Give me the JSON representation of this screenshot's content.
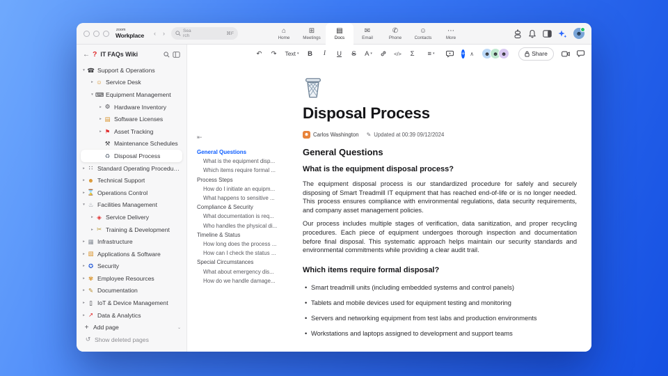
{
  "topbar": {
    "logo_small": "zoom",
    "logo_bold": "Workplace",
    "nav_prev": "‹",
    "nav_next": "›",
    "search": {
      "placeholder": "Search",
      "shortcut": "⌘F"
    },
    "tabs": [
      {
        "name": "home",
        "label": "Home",
        "glyph": "⌂"
      },
      {
        "name": "meetings",
        "label": "Meetings",
        "glyph": "⊞"
      },
      {
        "name": "docs",
        "label": "Docs",
        "glyph": "▤",
        "cls": "active"
      },
      {
        "name": "email",
        "label": "Email",
        "glyph": "✉"
      },
      {
        "name": "phone",
        "label": "Phone",
        "glyph": "✆"
      },
      {
        "name": "contacts",
        "label": "Contacts",
        "glyph": "☺"
      },
      {
        "name": "more",
        "label": "More",
        "glyph": "⋯"
      }
    ],
    "avatar_glyph": "☻"
  },
  "sidebar": {
    "title": "IT FAQs Wiki",
    "back_glyph": "←",
    "wiki_icon_glyph": "?",
    "items": [
      {
        "name": "support-operations",
        "label": "Support & Operations",
        "cls": "lv0",
        "chev": "▾",
        "icon": {
          "name": "phone-receiver-icon",
          "glyph": "☎",
          "color": "#3a3a3e"
        }
      },
      {
        "name": "service-desk",
        "label": "Service Desk",
        "cls": "lv1",
        "chev": "▸",
        "icon": {
          "name": "service-desk-icon",
          "glyph": "☺",
          "color": "#d9932b"
        }
      },
      {
        "name": "equipment-management",
        "label": "Equipment Management",
        "cls": "lv1",
        "chev": "▾",
        "icon": {
          "name": "computer-icon",
          "glyph": "⌨",
          "color": "#3a3a3e"
        }
      },
      {
        "name": "hardware-inventory",
        "label": "Hardware Inventory",
        "cls": "lv2",
        "chev": "▸",
        "icon": {
          "name": "hardware-icon",
          "glyph": "⚙",
          "color": "#4a4a50"
        }
      },
      {
        "name": "software-licenses",
        "label": "Software Licenses",
        "cls": "lv2",
        "chev": "▸",
        "icon": {
          "name": "license-card-icon",
          "glyph": "▤",
          "color": "#d9932b"
        }
      },
      {
        "name": "asset-tracking",
        "label": "Asset Tracking",
        "cls": "lv2",
        "chev": "▸",
        "icon": {
          "name": "pin-icon",
          "glyph": "⚑",
          "color": "#e02b2b"
        }
      },
      {
        "name": "maintenance-schedules",
        "label": "Maintenance Schedules",
        "cls": "lv2",
        "chev": "",
        "icon": {
          "name": "tools-icon",
          "glyph": "⚒",
          "color": "#3a3a3e"
        }
      },
      {
        "name": "disposal-process",
        "label": "Disposal Process",
        "cls": "lv2 selected",
        "chev": "",
        "icon": {
          "name": "wastebasket-icon",
          "glyph": "♻",
          "color": "#78828e"
        }
      },
      {
        "name": "standard-operating-procedures",
        "label": "Standard Operating Procedures",
        "cls": "lv0",
        "chev": "▸",
        "icon": {
          "name": "footprints-icon",
          "glyph": "∷",
          "color": "#3a3a3e"
        }
      },
      {
        "name": "technical-support",
        "label": "Technical Support",
        "cls": "lv0",
        "chev": "▸",
        "icon": {
          "name": "worker-icon",
          "glyph": "☻",
          "color": "#d9932b"
        }
      },
      {
        "name": "operations-control",
        "label": "Operations Control",
        "cls": "lv0",
        "chev": "▸",
        "icon": {
          "name": "hourglass-icon",
          "glyph": "⌛",
          "color": "#3a3a3e"
        }
      },
      {
        "name": "facilities-management",
        "label": "Facilities Management",
        "cls": "lv0",
        "chev": "▾",
        "icon": {
          "name": "facilities-icon",
          "glyph": "♨",
          "color": "#8a9099"
        }
      },
      {
        "name": "service-delivery",
        "label": "Service Delivery",
        "cls": "lv1",
        "chev": "▸",
        "icon": {
          "name": "truck-icon",
          "glyph": "◈",
          "color": "#e02b2b"
        }
      },
      {
        "name": "training-development",
        "label": "Training & Development",
        "cls": "lv1",
        "chev": "▸",
        "icon": {
          "name": "training-icon",
          "glyph": "✂",
          "color": "#b5952a"
        }
      },
      {
        "name": "infrastructure",
        "label": "Infrastructure",
        "cls": "lv0",
        "chev": "▸",
        "icon": {
          "name": "building-icon",
          "glyph": "▦",
          "color": "#8a9099"
        }
      },
      {
        "name": "applications-software",
        "label": "Applications & Software",
        "cls": "lv0",
        "chev": "▸",
        "icon": {
          "name": "laptop-icon",
          "glyph": "▧",
          "color": "#d9932b"
        }
      },
      {
        "name": "security",
        "label": "Security",
        "cls": "lv0",
        "chev": "▸",
        "icon": {
          "name": "officer-icon",
          "glyph": "✪",
          "color": "#2b5fd9"
        }
      },
      {
        "name": "employee-resources",
        "label": "Employee Resources",
        "cls": "lv0",
        "chev": "▸",
        "icon": {
          "name": "person-icon",
          "glyph": "✾",
          "color": "#d9932b"
        }
      },
      {
        "name": "documentation",
        "label": "Documentation",
        "cls": "lv0",
        "chev": "▸",
        "icon": {
          "name": "memo-pencil-icon",
          "glyph": "✎",
          "color": "#b5892a"
        }
      },
      {
        "name": "iot-device-management",
        "label": "IoT & Device Management",
        "cls": "lv0",
        "chev": "▸",
        "icon": {
          "name": "mobile-phone-icon",
          "glyph": "▯",
          "color": "#2e2e33"
        }
      },
      {
        "name": "data-analytics",
        "label": "Data & Analytics",
        "cls": "lv0",
        "chev": "▸",
        "icon": {
          "name": "chart-up-icon",
          "glyph": "↗",
          "color": "#e02b2b"
        }
      }
    ],
    "add_page_label": "Add page",
    "add_page_glyph": "+",
    "add_page_caret": "⌄",
    "show_deleted_label": "Show deleted pages",
    "show_deleted_glyph": "↺"
  },
  "toolbar": {
    "undo": "↶",
    "redo": "↷",
    "text_style": "Text",
    "caret": "▾",
    "bold": "B",
    "italic": "I",
    "underline": "U",
    "strikethrough": "S",
    "text_color": "A",
    "code": "</>",
    "equation": "Σ",
    "align": "≡",
    "collapse": "∧",
    "share_label": "Share",
    "ai_plus": "+",
    "avatars": [
      {
        "name": "collaborator-1",
        "color": "#bcd9f7",
        "glyph": "☻"
      },
      {
        "name": "collaborator-2",
        "color": "#bfe8cf",
        "glyph": "☻"
      },
      {
        "name": "collaborator-3",
        "color": "#d9c9f2",
        "glyph": "☻"
      }
    ],
    "accent_blue": "#0b5cff"
  },
  "outline": {
    "collapse_glyph": "⇤",
    "items": [
      {
        "name": "general-questions",
        "label": "General Questions",
        "cls": "section active"
      },
      {
        "name": "q-what-is-disposal",
        "label": "What is the equipment disp...",
        "cls": "sub"
      },
      {
        "name": "q-which-items",
        "label": "Which items require formal ...",
        "cls": "sub"
      },
      {
        "name": "process-steps",
        "label": "Process Steps",
        "cls": "section"
      },
      {
        "name": "q-how-initiate",
        "label": "How do I initiate an equipm...",
        "cls": "sub"
      },
      {
        "name": "q-sensitive-data",
        "label": "What happens to sensitive ...",
        "cls": "sub"
      },
      {
        "name": "compliance-security",
        "label": "Compliance & Security",
        "cls": "section"
      },
      {
        "name": "q-documentation",
        "label": "What documentation is req...",
        "cls": "sub"
      },
      {
        "name": "q-who-handles",
        "label": "Who handles the physical di...",
        "cls": "sub"
      },
      {
        "name": "timeline-status",
        "label": "Timeline & Status",
        "cls": "section"
      },
      {
        "name": "q-how-long",
        "label": "How long does the process ...",
        "cls": "sub"
      },
      {
        "name": "q-check-status",
        "label": "How can I check the status ...",
        "cls": "sub"
      },
      {
        "name": "special-circumstances",
        "label": "Special Circumstances",
        "cls": "section"
      },
      {
        "name": "q-emergency",
        "label": "What about emergency dis...",
        "cls": "sub"
      },
      {
        "name": "q-damage",
        "label": "How do we handle damage...",
        "cls": "sub"
      }
    ]
  },
  "doc": {
    "title": "Disposal Process",
    "author": "Carlos Washington",
    "author_avatar_glyph": "☻",
    "updated": "Updated at 00:39 09/12/2024",
    "edit_glyph": "✎",
    "h2": "General Questions",
    "q1": "What is the equipment disposal process?",
    "p1": "The equipment disposal process is our standardized procedure for safely and securely disposing of Smart Treadmill IT equipment that has reached end-of-life or is no longer needed. This process ensures compliance with environmental regulations, data security requirements, and company asset management policies.",
    "p2": "Our process includes multiple stages of verification, data sanitization, and proper recycling procedures. Each piece of equipment undergoes thorough inspection and documentation before final disposal. This systematic approach helps maintain our security standards and environmental commitments while providing a clear audit trail.",
    "q2": "Which items require formal disposal?",
    "bullets": [
      "Smart treadmill units (including embedded systems and control panels)",
      "Tablets and mobile devices used for equipment testing and monitoring",
      "Servers and networking equipment from test labs and production environments",
      "Workstations and laptops assigned to development and support teams"
    ]
  }
}
